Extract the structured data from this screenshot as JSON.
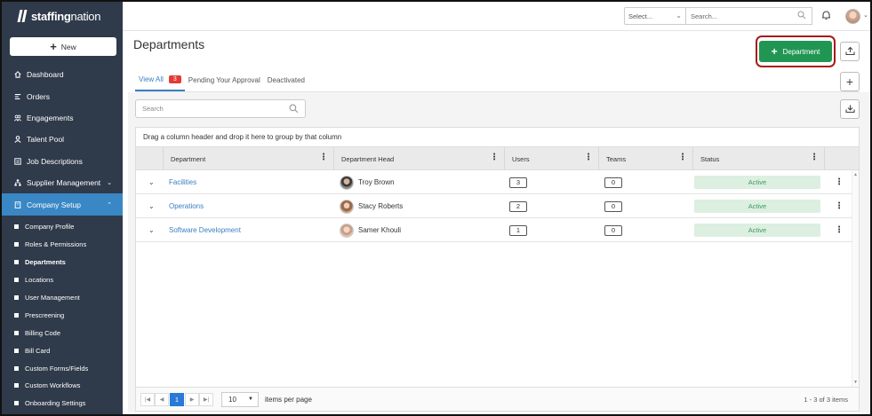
{
  "brand": {
    "bold": "staffing",
    "light": "nation"
  },
  "sidebar": {
    "new_label": "New",
    "items": [
      {
        "label": "Dashboard",
        "icon": "home-icon"
      },
      {
        "label": "Orders",
        "icon": "orders-icon"
      },
      {
        "label": "Engagements",
        "icon": "people-icon"
      },
      {
        "label": "Talent Pool",
        "icon": "person-icon"
      },
      {
        "label": "Job Descriptions",
        "icon": "document-icon"
      },
      {
        "label": "Supplier Management",
        "icon": "hierarchy-icon"
      },
      {
        "label": "Company Setup",
        "icon": "building-icon"
      }
    ],
    "sub_items": [
      "Company Profile",
      "Roles & Permissions",
      "Departments",
      "Locations",
      "User Management",
      "Prescreening",
      "Billing Code",
      "Bill Card",
      "Custom Forms/Fields",
      "Custom Workflows",
      "Onboarding Settings"
    ]
  },
  "topbar": {
    "select_placeholder": "Select...",
    "search_placeholder": "Search..."
  },
  "page": {
    "title": "Departments",
    "add_label": "Department",
    "tabs": [
      {
        "label": "View All",
        "badge": "3"
      },
      {
        "label": "Pending Your Approval"
      },
      {
        "label": "Deactivated"
      }
    ],
    "search_placeholder": "Search"
  },
  "grid": {
    "group_hint": "Drag a column header and drop it here to group by that column",
    "columns": [
      "Department",
      "Department Head",
      "Users",
      "Teams",
      "Status"
    ],
    "rows": [
      {
        "department": "Facilities",
        "head": "Troy Brown",
        "users": "3",
        "teams": "0",
        "status": "Active"
      },
      {
        "department": "Operations",
        "head": "Stacy Roberts",
        "users": "2",
        "teams": "0",
        "status": "Active"
      },
      {
        "department": "Software Development",
        "head": "Samer Khouli",
        "users": "1",
        "teams": "0",
        "status": "Active"
      }
    ],
    "pager": {
      "page": "1",
      "page_size": "10",
      "per_page_label": "items per page",
      "range": "1 - 3 of 3 items"
    }
  },
  "colors": {
    "sidebar_bg": "#2f3a4a",
    "active_nav": "#3a87c5",
    "primary": "#219653",
    "link": "#3a7fc1",
    "badge": "#e53935"
  }
}
